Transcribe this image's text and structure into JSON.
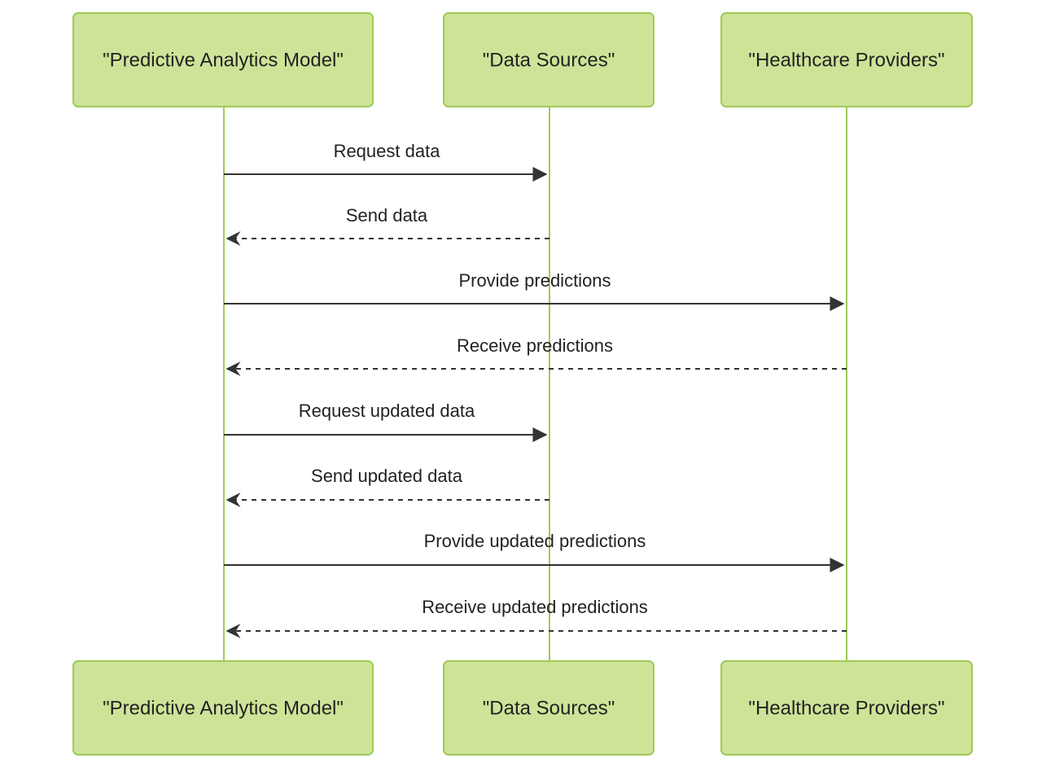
{
  "colors": {
    "participant_fill": "#cde498",
    "participant_stroke": "#9fcb56",
    "lifeline": "#9fcb56",
    "message_line": "#333333",
    "text": "#222222"
  },
  "participants": [
    {
      "id": "model",
      "label": "\"Predictive Analytics Model\""
    },
    {
      "id": "sources",
      "label": "\"Data Sources\""
    },
    {
      "id": "providers",
      "label": "\"Healthcare Providers\""
    }
  ],
  "messages": [
    {
      "from": "model",
      "to": "sources",
      "label": "Request data",
      "style": "solid"
    },
    {
      "from": "sources",
      "to": "model",
      "label": "Send data",
      "style": "dashed"
    },
    {
      "from": "model",
      "to": "providers",
      "label": "Provide predictions",
      "style": "solid"
    },
    {
      "from": "providers",
      "to": "model",
      "label": "Receive predictions",
      "style": "dashed"
    },
    {
      "from": "model",
      "to": "sources",
      "label": "Request updated data",
      "style": "solid"
    },
    {
      "from": "sources",
      "to": "model",
      "label": "Send updated data",
      "style": "dashed"
    },
    {
      "from": "model",
      "to": "providers",
      "label": "Provide updated predictions",
      "style": "solid"
    },
    {
      "from": "providers",
      "to": "model",
      "label": "Receive updated predictions",
      "style": "dashed"
    }
  ]
}
